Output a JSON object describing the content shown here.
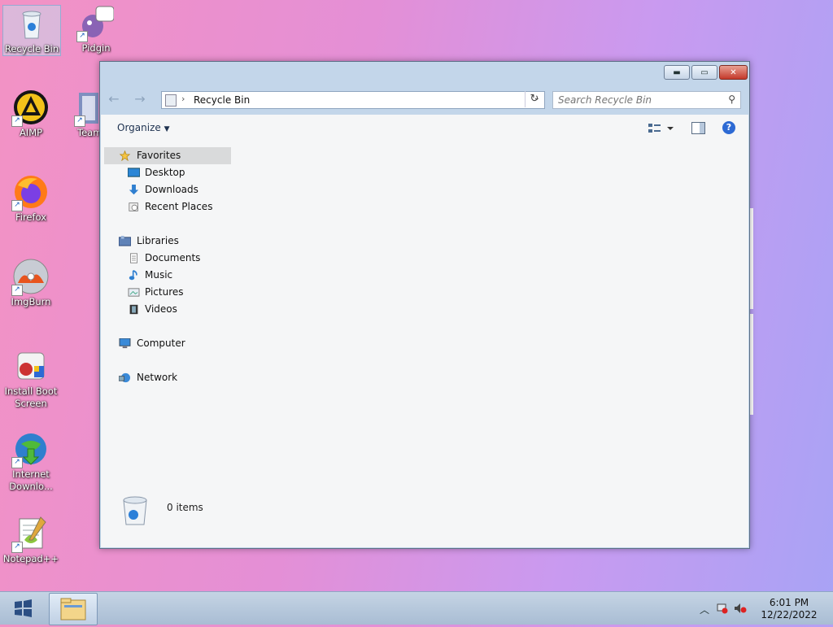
{
  "desktop": {
    "icons": [
      {
        "label": "Recycle Bin",
        "icon": "recycle-bin-icon"
      },
      {
        "label": "Pidgin",
        "icon": "pidgin-icon"
      },
      {
        "label": "AIMP",
        "icon": "aimp-icon"
      },
      {
        "label": "Team",
        "icon": "teamviewer-icon"
      },
      {
        "label": "Firefox",
        "icon": "firefox-icon"
      },
      {
        "label": "ImgBurn",
        "icon": "imgburn-icon"
      },
      {
        "label": "Install Boot Screen",
        "icon": "install-boot-screen-icon"
      },
      {
        "label": "Internet Downlo...",
        "icon": "internet-download-manager-icon"
      },
      {
        "label": "Notepad++",
        "icon": "notepadpp-icon"
      }
    ]
  },
  "window": {
    "address": {
      "path": "Recycle Bin"
    },
    "search": {
      "placeholder": "Search Recycle Bin"
    },
    "toolbar": {
      "organize_label": "Organize"
    },
    "nav": {
      "favorites": "Favorites",
      "desktop": "Desktop",
      "downloads": "Downloads",
      "recent_places": "Recent Places",
      "libraries": "Libraries",
      "documents": "Documents",
      "music": "Music",
      "pictures": "Pictures",
      "videos": "Videos",
      "computer": "Computer",
      "network": "Network"
    },
    "status": {
      "item_count": "0 items"
    }
  },
  "taskbar": {
    "clock": {
      "time": "6:01 PM",
      "date": "12/22/2022"
    }
  },
  "colors": {
    "accent": "#2d6ad4",
    "selection": "#d9dadb"
  }
}
